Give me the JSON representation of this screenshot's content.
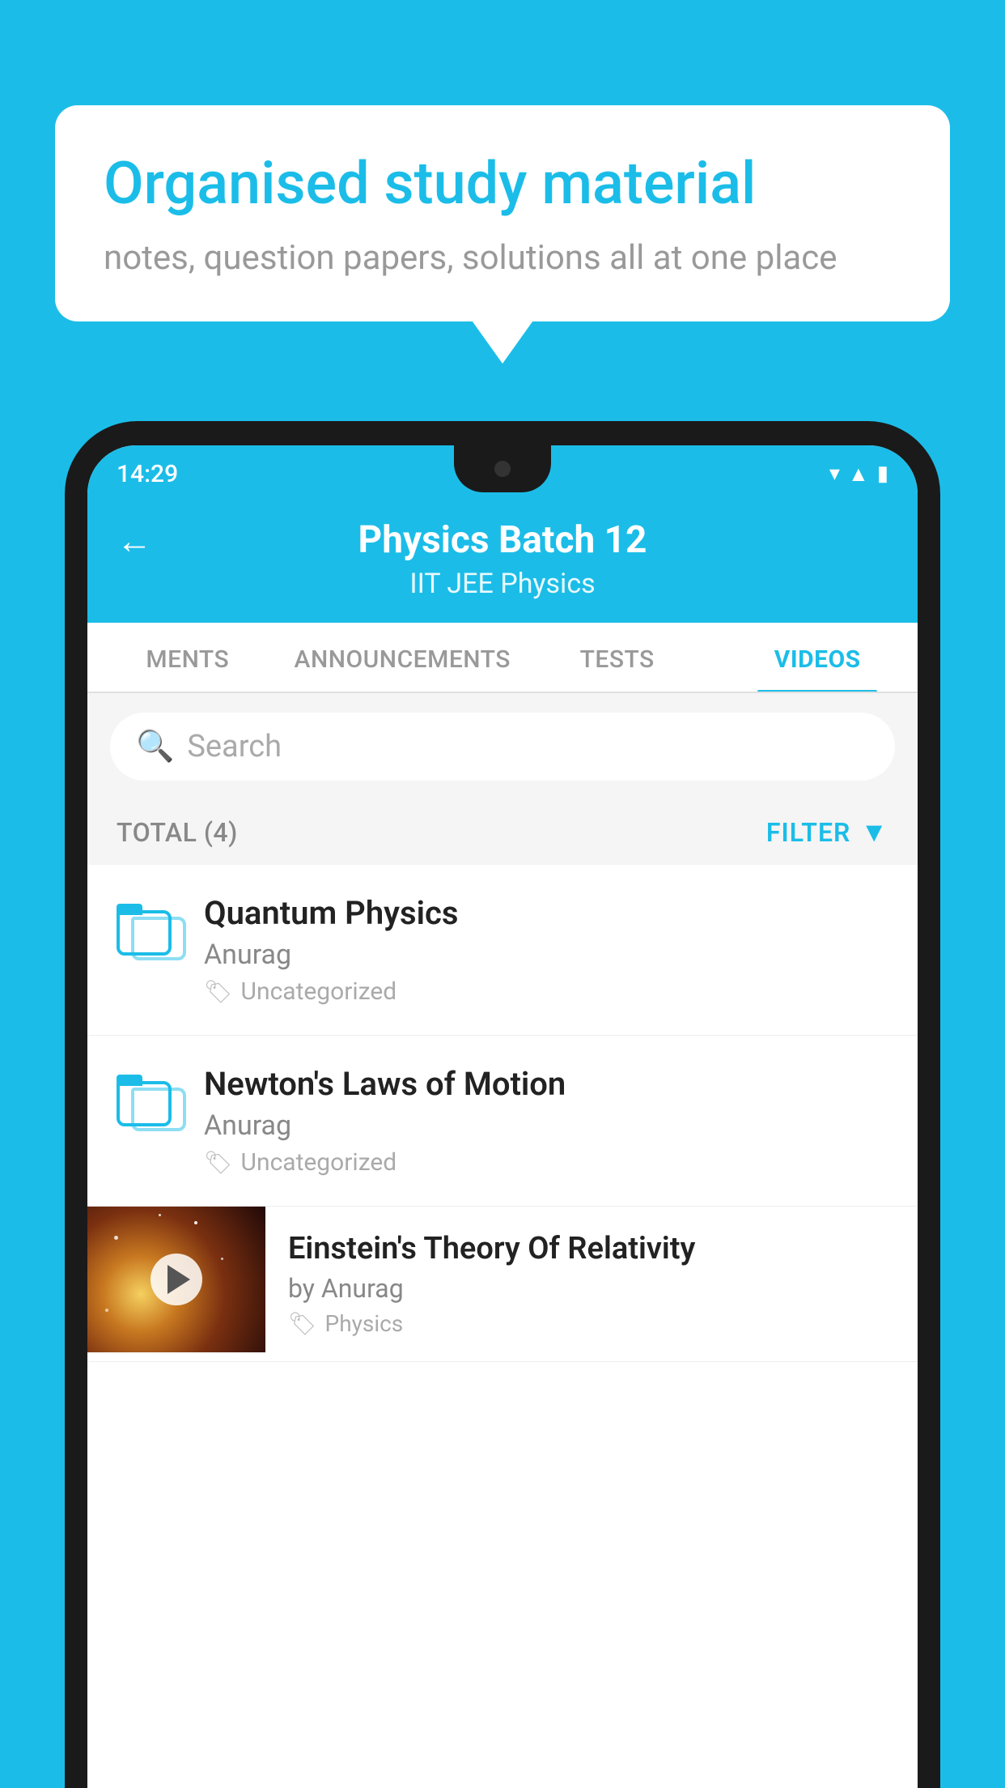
{
  "background_color": "#1BBDE8",
  "speech_bubble": {
    "title": "Organised study material",
    "subtitle": "notes, question papers, solutions all at one place"
  },
  "status_bar": {
    "time": "14:29",
    "icons": [
      "wifi",
      "signal",
      "battery"
    ]
  },
  "app_header": {
    "back_label": "←",
    "title": "Physics Batch 12",
    "subtitle": "IIT JEE   Physics"
  },
  "tabs": [
    {
      "label": "MENTS",
      "active": false
    },
    {
      "label": "ANNOUNCEMENTS",
      "active": false
    },
    {
      "label": "TESTS",
      "active": false
    },
    {
      "label": "VIDEOS",
      "active": true
    }
  ],
  "search": {
    "placeholder": "Search"
  },
  "filter_row": {
    "total_label": "TOTAL (4)",
    "filter_label": "FILTER"
  },
  "videos": [
    {
      "title": "Quantum Physics",
      "author": "Anurag",
      "tag": "Uncategorized",
      "has_thumbnail": false
    },
    {
      "title": "Newton's Laws of Motion",
      "author": "Anurag",
      "tag": "Uncategorized",
      "has_thumbnail": false
    },
    {
      "title": "Einstein's Theory Of Relativity",
      "author": "by Anurag",
      "tag": "Physics",
      "has_thumbnail": true
    }
  ]
}
